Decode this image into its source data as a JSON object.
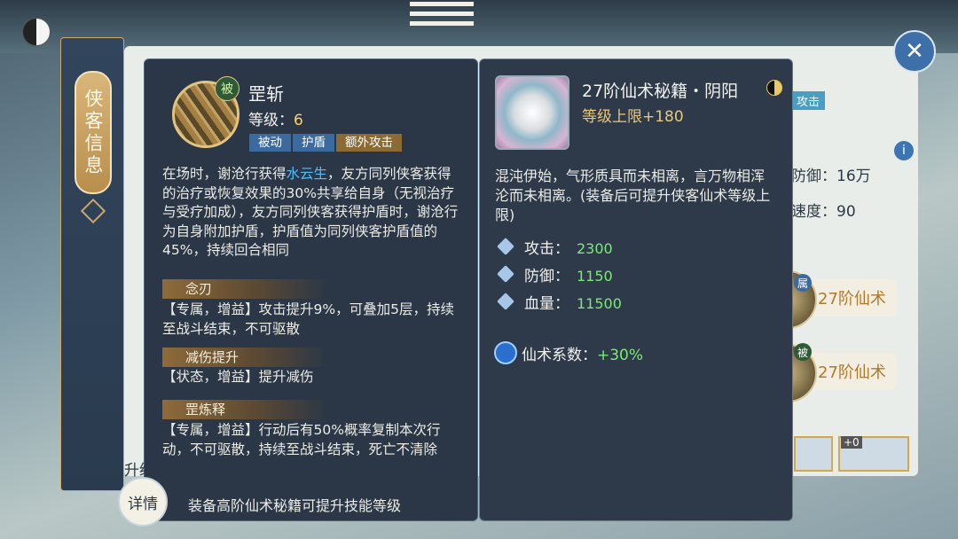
{
  "skill": {
    "icon_badge": "被",
    "name": "罡斩",
    "level_label": "等级：",
    "level_value": "6",
    "tags": [
      "被动",
      "护盾",
      "额外攻击"
    ],
    "desc_part1": "在场时，谢沧行获得",
    "desc_highlight": "水云生",
    "desc_part2": "，友方同列侠客获得的治疗或恢复效果的30%共享给自身（无视治疗与受疗加成），友方同列侠客获得护盾时，谢沧行为自身附加护盾，护盾值为同列侠客护盾值的45%，持续回合相同",
    "effects": [
      {
        "title": "念刃",
        "text": "【专属，增益】攻击提升9%，可叠加5层，持续至战斗结束，不可驱散"
      },
      {
        "title": "减伤提升",
        "text": "【状态，增益】提升减伤"
      },
      {
        "title": "罡炼释",
        "text": "【专属，增益】行动后有50%概率复制本次行动，不可驱散，持续至战斗结束，死亡不清除"
      }
    ],
    "footer": "装备高阶仙术秘籍可提升技能等级"
  },
  "manual": {
    "title": "27阶仙术秘籍・阴阳",
    "limit": "等级上限+180",
    "desc": "混沌伊始，气形质具而未相离，言万物相浑沦而未相离。(装备后可提升侠客仙术等级上限)",
    "stats": [
      {
        "label": "攻击：",
        "value": "2300",
        "icon": "attack-icon"
      },
      {
        "label": "防御：",
        "value": "1150",
        "icon": "defense-icon"
      },
      {
        "label": "血量：",
        "value": "11500",
        "icon": "hp-icon"
      }
    ],
    "coef_label": "仙术系数：",
    "coef_value": "+30%"
  },
  "sidebar": {
    "tab_label": "侠客信息"
  },
  "buttons": {
    "upgrade": "升级",
    "detail": "详情",
    "close": "✕"
  },
  "background": {
    "tag_attack": "攻击",
    "defense": "防御：16万",
    "speed": "速度：90",
    "spell1": "27阶仙术",
    "spell2": "27阶仙术",
    "spell1_badge": "属",
    "spell2_badge": "被",
    "slot_plus": "+0"
  }
}
